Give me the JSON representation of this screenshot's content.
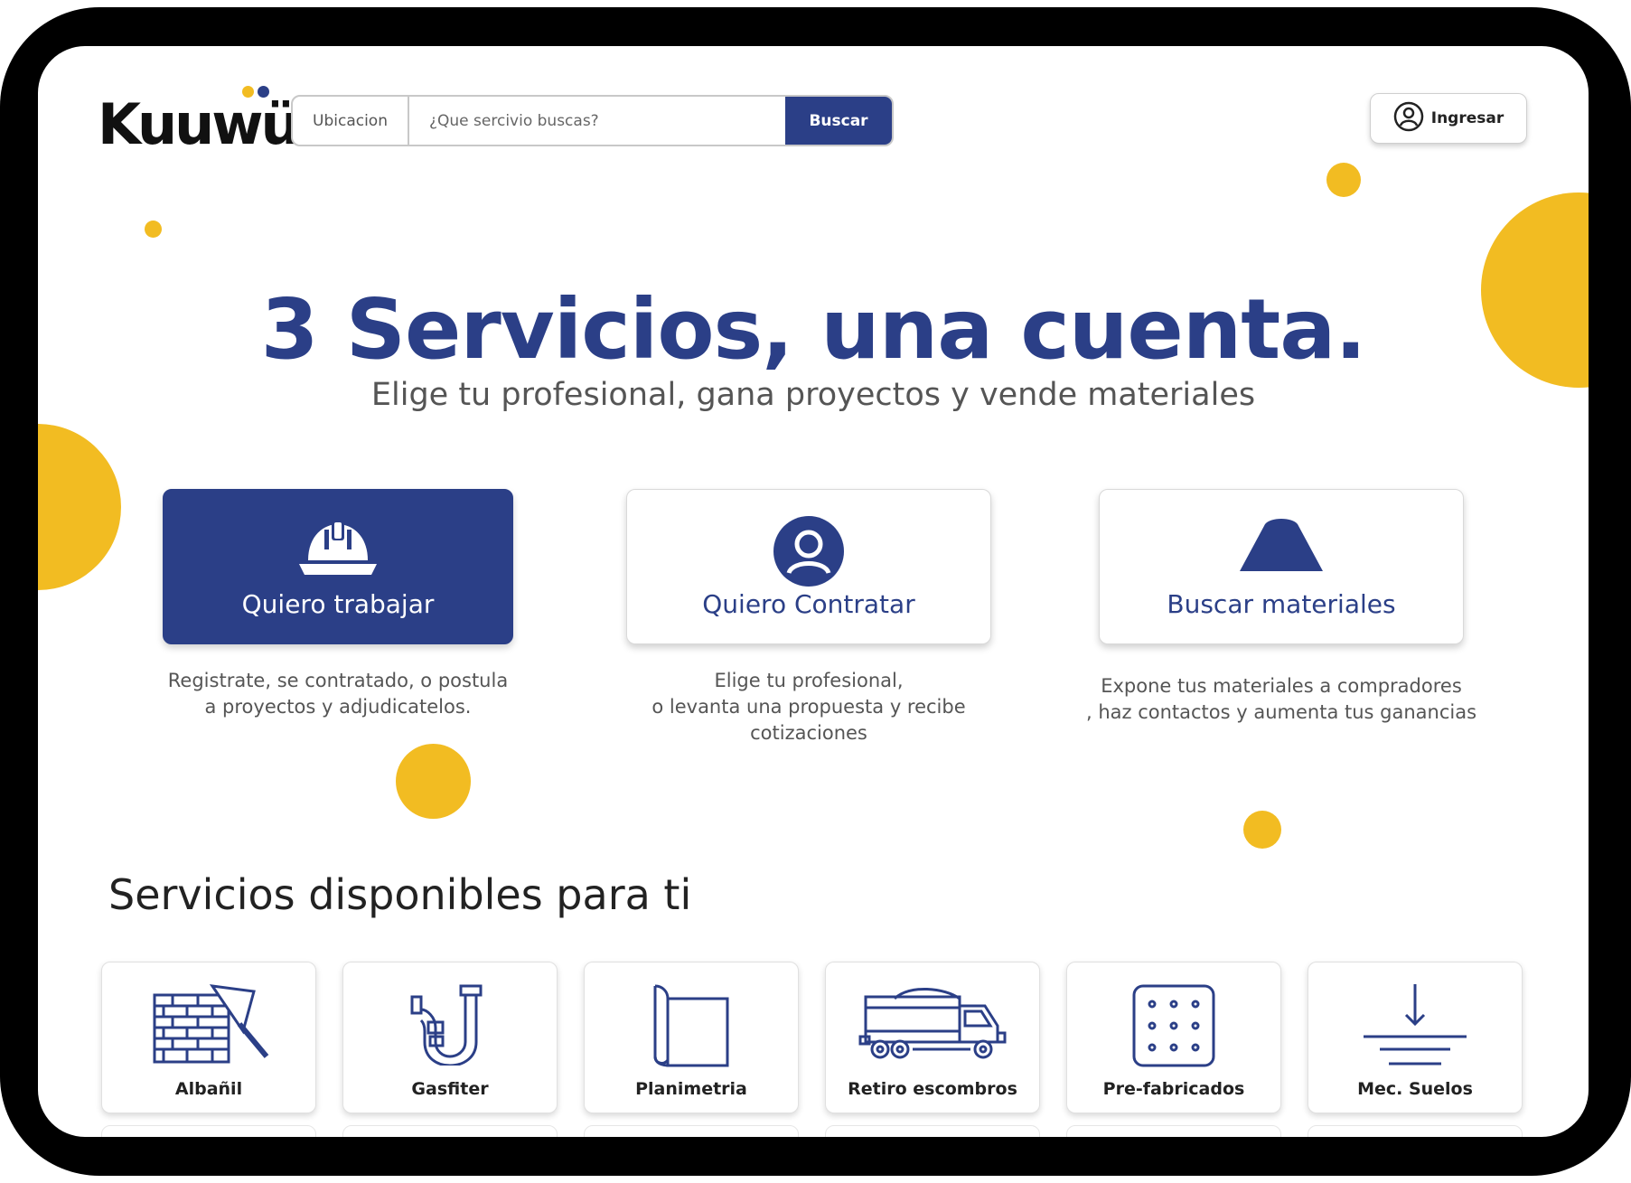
{
  "brand": {
    "logo_text": "Kuuwü",
    "accent": "#F2BC22",
    "primary": "#2B3F87"
  },
  "header": {
    "location_label": "Ubicacion",
    "search_placeholder": "¿Que sercivio buscas?",
    "search_button": "Buscar",
    "login_label": "Ingresar"
  },
  "hero": {
    "title": "3 Servicios, una cuenta.",
    "subtitle": "Elige tu profesional, gana proyectos y vende materiales"
  },
  "options": [
    {
      "icon": "hard-hat-icon",
      "label": "Quiero trabajar",
      "description": "Registrate, se contratado, o postula\na proyectos y  adjudicatelos."
    },
    {
      "icon": "user-circle-icon",
      "label": "Quiero Contratar",
      "description": "Elige tu profesional,\no levanta una propuesta y recibe\ncotizaciones"
    },
    {
      "icon": "material-pile-icon",
      "label": "Buscar materiales",
      "description": "Expone tus materiales a compradores\n, haz contactos y aumenta tus ganancias"
    }
  ],
  "services": {
    "title": "Servicios disponibles para ti",
    "items": [
      {
        "icon": "brick-wall-trowel-icon",
        "label": "Albañil"
      },
      {
        "icon": "pipe-icon",
        "label": "Gasfiter"
      },
      {
        "icon": "blueprint-icon",
        "label": "Planimetria"
      },
      {
        "icon": "dump-truck-icon",
        "label": "Retiro escombros"
      },
      {
        "icon": "precast-panel-icon",
        "label": "Pre-fabricados"
      },
      {
        "icon": "soil-mechanics-icon",
        "label": "Mec. Suelos"
      }
    ]
  }
}
